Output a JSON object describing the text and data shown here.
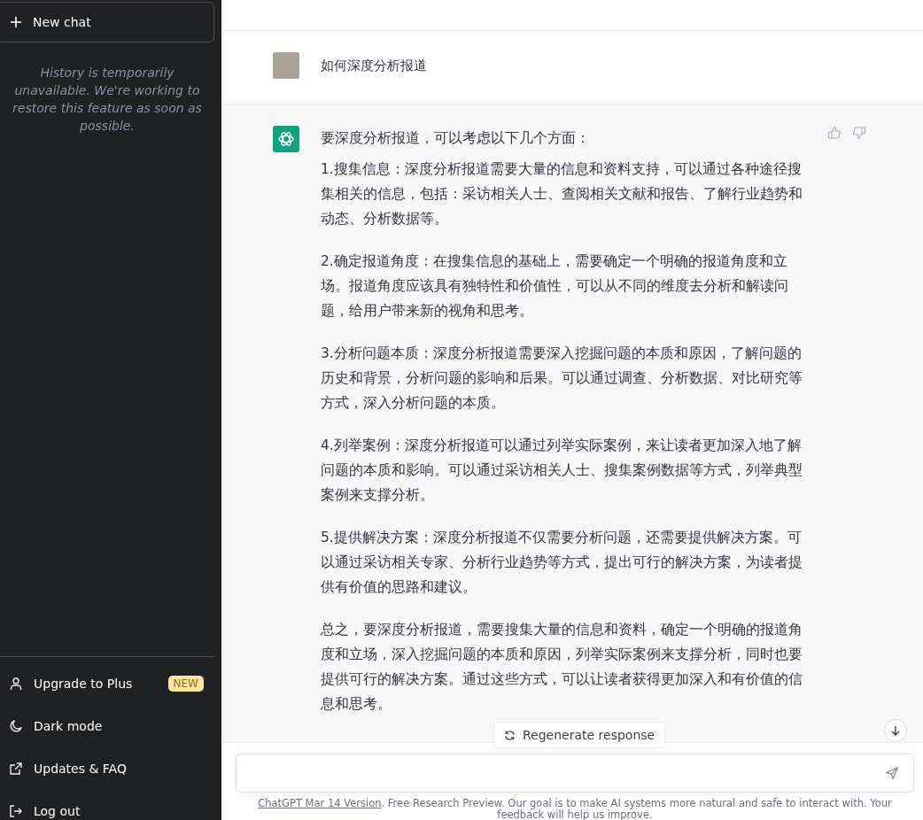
{
  "sidebar": {
    "new_chat": {
      "label": "New chat"
    },
    "history_notice": "History is temporarily unavailable. We're working to restore this feature as soon as possible.",
    "menu": [
      {
        "kind": "user",
        "label": "Upgrade to Plus",
        "badge": "NEW"
      },
      {
        "kind": "moon",
        "label": "Dark mode"
      },
      {
        "kind": "external",
        "label": "Updates & FAQ"
      },
      {
        "kind": "logout",
        "label": "Log out"
      }
    ]
  },
  "conversation": {
    "user_message": "如何深度分析报道",
    "assistant_paragraphs": [
      "要深度分析报道，可以考虑以下几个方面：",
      "1.搜集信息：深度分析报道需要大量的信息和资料支持，可以通过各种途径搜集相关的信息，包括：采访相关人士、查阅相关文献和报告、了解行业趋势和动态、分析数据等。",
      "2.确定报道角度：在搜集信息的基础上，需要确定一个明确的报道角度和立场。报道角度应该具有独特性和价值性，可以从不同的维度去分析和解读问题，给用户带来新的视角和思考。",
      "3.分析问题本质：深度分析报道需要深入挖掘问题的本质和原因，了解问题的历史和背景，分析问题的影响和后果。可以通过调查、分析数据、对比研究等方式，深入分析问题的本质。",
      "4.列举案例：深度分析报道可以通过列举实际案例，来让读者更加深入地了解问题的本质和影响。可以通过采访相关人士、搜集案例数据等方式，列举典型案例来支撑分析。",
      "5.提供解决方案：深度分析报道不仅需要分析问题，还需要提供解决方案。可以通过采访相关专家、分析行业趋势等方式，提出可行的解决方案，为读者提供有价值的思路和建议。",
      "总之，要深度分析报道，需要搜集大量的信息和资料，确定一个明确的报道角度和立场，深入挖掘问题的本质和原因，列举实际案例来支撑分析，同时也要提供可行的解决方案。通过这些方式，可以让读者获得更加深入和有价值的信息和思考。"
    ]
  },
  "regenerate_button": "Regenerate response",
  "footer": {
    "link": "ChatGPT Mar 14 Version",
    "text": ". Free Research Preview. Our goal is to make AI systems more natural and safe to interact with. Your feedback will help us improve."
  }
}
